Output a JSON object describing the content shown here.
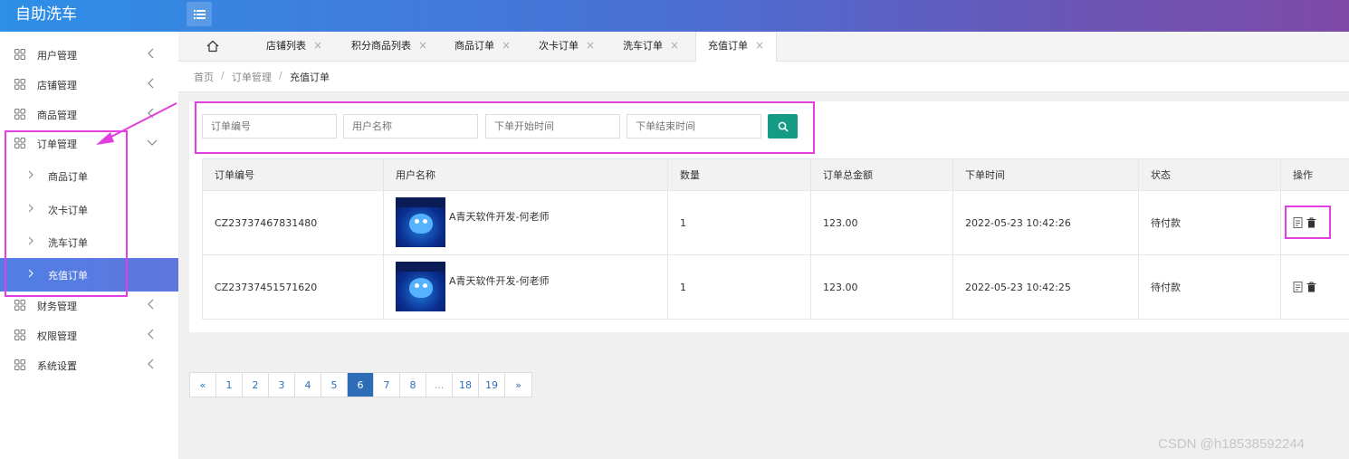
{
  "app": {
    "brand": "自助洗车"
  },
  "colors": {
    "accent": "#169c86",
    "annotation": "#e33fe0",
    "active_menu": "#5479e2",
    "page_active": "#2d6db5"
  },
  "sidebar": {
    "items": [
      {
        "label": "用户管理",
        "icon": "grid-icon"
      },
      {
        "label": "店铺管理",
        "icon": "grid-icon"
      },
      {
        "label": "商品管理",
        "icon": "grid-icon"
      },
      {
        "label": "订单管理",
        "icon": "grid-icon",
        "expanded": true,
        "children": [
          {
            "label": "商品订单"
          },
          {
            "label": "次卡订单"
          },
          {
            "label": "洗车订单"
          },
          {
            "label": "充值订单",
            "active": true
          }
        ]
      },
      {
        "label": "财务管理",
        "icon": "grid-icon"
      },
      {
        "label": "权限管理",
        "icon": "grid-icon"
      },
      {
        "label": "系统设置",
        "icon": "grid-icon"
      }
    ]
  },
  "tabs": [
    {
      "label": "店铺列表"
    },
    {
      "label": "积分商品列表"
    },
    {
      "label": "商品订单"
    },
    {
      "label": "次卡订单"
    },
    {
      "label": "洗车订单"
    },
    {
      "label": "充值订单",
      "active": true
    }
  ],
  "tab_close": "×",
  "breadcrumb": {
    "items": [
      "首页",
      "订单管理",
      "充值订单"
    ],
    "separator": "/"
  },
  "search": {
    "order_no_placeholder": "订单编号",
    "username_placeholder": "用户名称",
    "start_time_placeholder": "下单开始时间",
    "end_time_placeholder": "下单结束时间"
  },
  "table": {
    "headers": [
      "订单编号",
      "用户名称",
      "数量",
      "订单总金额",
      "下单时间",
      "状态",
      "操作"
    ],
    "rows": [
      {
        "order_no": "CZ23737467831480",
        "username": "A青天软件开发-何老师",
        "qty": "1",
        "amount": "123.00",
        "time": "2022-05-23 10:42:26",
        "status": "待付款"
      },
      {
        "order_no": "CZ23737451571620",
        "username": "A青天软件开发-何老师",
        "qty": "1",
        "amount": "123.00",
        "time": "2022-05-23 10:42:25",
        "status": "待付款"
      }
    ]
  },
  "pagination": {
    "prev": "«",
    "next": "»",
    "pages": [
      "1",
      "2",
      "3",
      "4",
      "5",
      "6",
      "7",
      "8",
      "...",
      "18",
      "19"
    ],
    "current": "6"
  },
  "watermark": "CSDN @h18538592244"
}
